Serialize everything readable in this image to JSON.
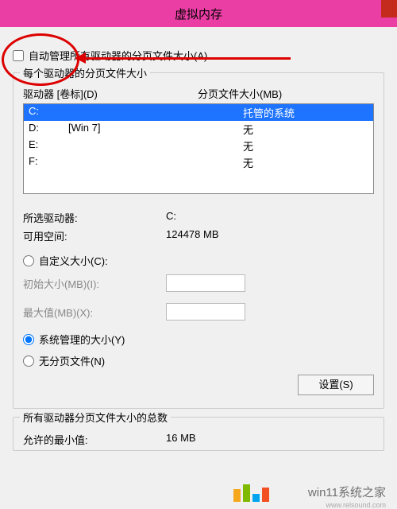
{
  "title": "虚拟内存",
  "auto_manage_label": "自动管理所有驱动器的分页文件大小(A)",
  "group1": {
    "title": "每个驱动器的分页文件大小",
    "col_drive": "驱动器 [卷标](D)",
    "col_page": "分页文件大小(MB)",
    "rows": [
      {
        "d": "C:",
        "v": "",
        "p": "托管的系统",
        "sel": true
      },
      {
        "d": "D:",
        "v": "[Win 7]",
        "p": "无",
        "sel": false
      },
      {
        "d": "E:",
        "v": "",
        "p": "无",
        "sel": false
      },
      {
        "d": "F:",
        "v": "",
        "p": "无",
        "sel": false
      }
    ],
    "selected_drive": {
      "lbl": "所选驱动器:",
      "val": "C:"
    },
    "avail_space": {
      "lbl": "可用空间:",
      "val": "124478 MB"
    },
    "custom_label": "自定义大小(C):",
    "init_label": "初始大小(MB)(I):",
    "max_label": "最大值(MB)(X):",
    "sys_managed": "系统管理的大小(Y)",
    "no_page": "无分页文件(N)",
    "set_btn": "设置(S)"
  },
  "group2": {
    "title": "所有驱动器分页文件大小的总数",
    "min_allowed": {
      "lbl": "允许的最小值:",
      "val": "16 MB"
    }
  },
  "watermark": "win11系统之家",
  "watermark_url": "www.relsound.com"
}
